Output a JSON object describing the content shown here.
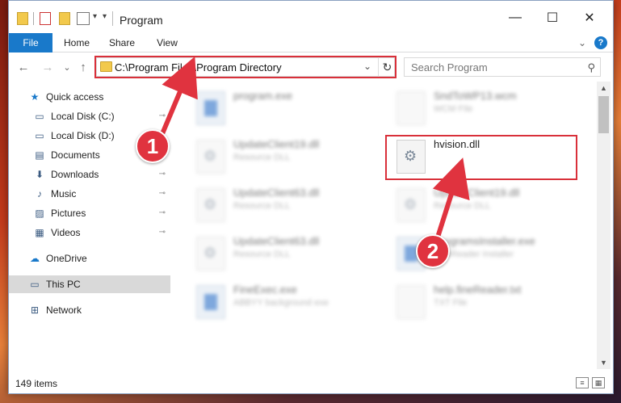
{
  "window": {
    "title": "Program",
    "controls": {
      "minimize": "—",
      "maximize": "☐",
      "close": "✕"
    }
  },
  "ribbon": {
    "tabs": [
      "File",
      "Home",
      "Share",
      "View"
    ],
    "expand": "⌄",
    "help": "?"
  },
  "nav": {
    "back": "←",
    "forward": "→",
    "recent": "⌄",
    "up": "↑",
    "address": "C:\\Program Files\\Program Directory",
    "address_dropdown": "⌄",
    "refresh": "↻",
    "search_placeholder": "Search Program",
    "search_icon": "⚲"
  },
  "sidebar": {
    "items": [
      {
        "label": "Quick access",
        "icon": "★",
        "pinned": false
      },
      {
        "label": "Local Disk (C:)",
        "icon": "▭",
        "pinned": true
      },
      {
        "label": "Local Disk (D:)",
        "icon": "▭",
        "pinned": false
      },
      {
        "label": "Documents",
        "icon": "▤",
        "pinned": true
      },
      {
        "label": "Downloads",
        "icon": "⬇",
        "pinned": true
      },
      {
        "label": "Music",
        "icon": "♪",
        "pinned": true
      },
      {
        "label": "Pictures",
        "icon": "▨",
        "pinned": true
      },
      {
        "label": "Videos",
        "icon": "▦",
        "pinned": true
      },
      {
        "label": "OneDrive",
        "icon": "☁",
        "pinned": false
      },
      {
        "label": "This PC",
        "icon": "▭",
        "pinned": false,
        "selected": true
      },
      {
        "label": "Network",
        "icon": "⊞",
        "pinned": false
      }
    ],
    "pin_icon": "📌"
  },
  "files": [
    {
      "name": "program.exe",
      "desc": "",
      "type": "exe",
      "blurred": true
    },
    {
      "name": "SndToWP13.wcm",
      "desc": "WCM File",
      "type": "doc",
      "blurred": true
    },
    {
      "name": "UpdateClient19.dll",
      "desc": "Resource DLL",
      "type": "gear",
      "blurred": true
    },
    {
      "name": "hvision.dll",
      "desc": "",
      "type": "gear",
      "blurred": false
    },
    {
      "name": "UpdateClient63.dll",
      "desc": "Resource DLL",
      "type": "gear",
      "blurred": true
    },
    {
      "name": "UpdateClient19.dll",
      "desc": "Resource DLL",
      "type": "gear",
      "blurred": true
    },
    {
      "name": "UpdateClient63.dll",
      "desc": "Resource DLL",
      "type": "gear",
      "blurred": true
    },
    {
      "name": "ProgramsInstaller.exe",
      "desc": "FineReader Installer",
      "type": "exe",
      "blurred": true
    },
    {
      "name": "FineExec.exe",
      "desc": "ABBYY background exe",
      "type": "exe",
      "blurred": true
    },
    {
      "name": "help.fineReader.txt",
      "desc": "TXT File",
      "type": "doc",
      "blurred": true
    }
  ],
  "status": {
    "count": "149 items"
  },
  "annotations": {
    "step1": "1",
    "step2": "2"
  },
  "colors": {
    "accent": "#1979ca",
    "highlight": "#d9303a"
  }
}
